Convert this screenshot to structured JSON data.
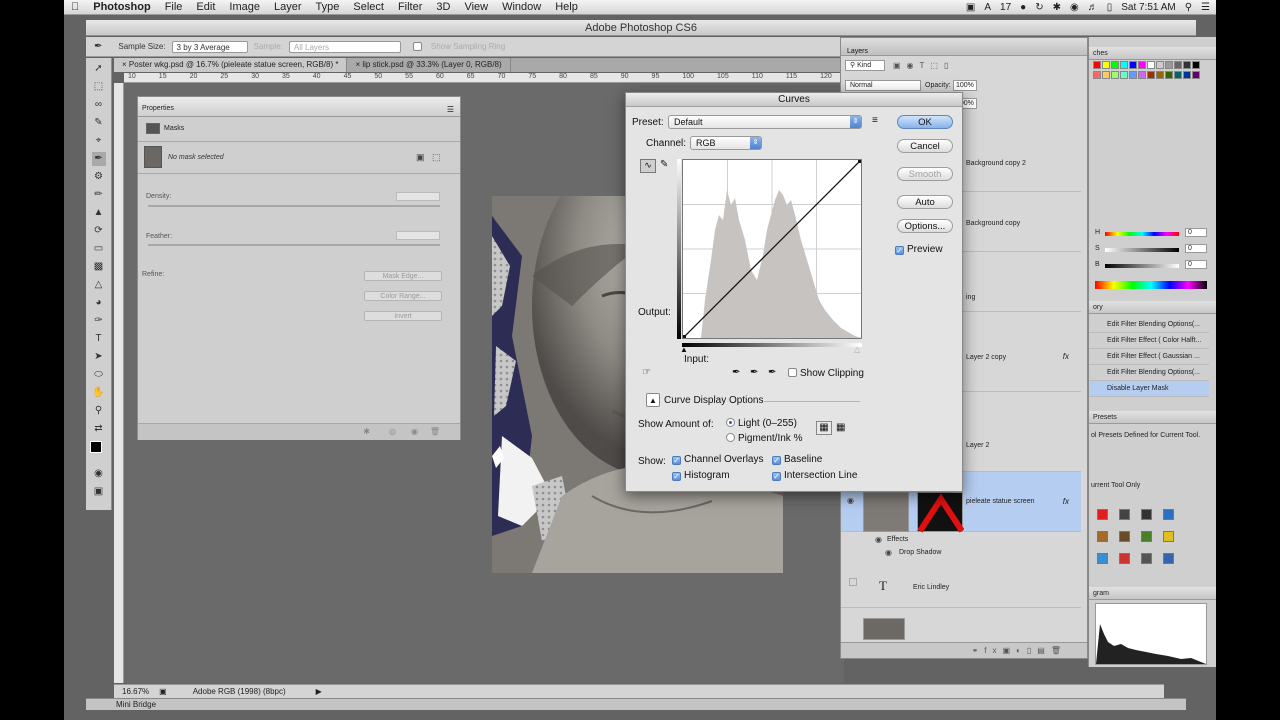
{
  "menubar": {
    "apple": "",
    "app_name": "Photoshop",
    "items": [
      "File",
      "Edit",
      "Image",
      "Layer",
      "Type",
      "Select",
      "Filter",
      "3D",
      "View",
      "Window",
      "Help"
    ],
    "status_number": "17",
    "clock": "Sat 7:51 AM"
  },
  "window": {
    "title": "Adobe Photoshop CS6"
  },
  "options_bar": {
    "sample_size_label": "Sample Size:",
    "sample_size_value": "3 by 3 Average",
    "sample_label": "Sample:",
    "sample_value": "All Layers",
    "show_ring": "Show Sampling Ring"
  },
  "doc_tabs": [
    {
      "label": "Poster wkg.psd @ 16.7% (pieleate statue screen, RGB/8) *"
    },
    {
      "label": "lip stick.psd @ 33.3% (Layer 0, RGB/8)"
    }
  ],
  "ruler_ticks": [
    "10",
    "15",
    "20",
    "25",
    "30",
    "35",
    "40",
    "45",
    "50",
    "55",
    "60",
    "65",
    "70",
    "75",
    "80",
    "85",
    "90",
    "95",
    "100",
    "105",
    "110",
    "115",
    "120",
    "125",
    "130",
    "135",
    "140",
    "145"
  ],
  "properties": {
    "title": "Properties",
    "section": "Masks",
    "no_mask": "No mask selected",
    "density": "Density:",
    "feather": "Feather:",
    "refine": "Refine:",
    "mask_edge": "Mask Edge...",
    "color_range": "Color Range...",
    "invert": "Invert"
  },
  "layers": {
    "title": "Layers",
    "kind": "Kind",
    "blend_mode": "Normal",
    "opacity_label": "Opacity:",
    "opacity_value": "100%",
    "fill_value": "100%",
    "items": [
      {
        "name": "Background copy 2"
      },
      {
        "name": "Background copy"
      },
      {
        "name": "ing"
      },
      {
        "name": "Layer 2 copy"
      },
      {
        "name": "Layer 2"
      },
      {
        "name": "pieleate statue screen"
      },
      {
        "name": "Effects"
      },
      {
        "name": "Drop Shadow"
      },
      {
        "name": "Eric Lindley"
      }
    ]
  },
  "right_panels": {
    "swatches_title": "ches",
    "color": {
      "h_label": "H",
      "s_label": "S",
      "b_label": "B",
      "h_value": "0",
      "s_value": "0",
      "b_value": "0",
      "pct": "%"
    },
    "history_title": "ory",
    "history_items": [
      "Edit Filter Blending Options(...",
      "Edit Filter Effect ( Color Halft...",
      "Edit Filter Effect ( Gaussian ...",
      "Edit Filter Blending Options(...",
      "Disable Layer Mask"
    ],
    "tool_presets_title": "Presets",
    "tool_presets_text": "ol Presets Defined for Current Tool.",
    "current_tool_only": "urrent Tool Only",
    "histogram_title": "gram"
  },
  "curves": {
    "title": "Curves",
    "preset_label": "Preset:",
    "preset_value": "Default",
    "channel_label": "Channel:",
    "channel_value": "RGB",
    "ok": "OK",
    "cancel": "Cancel",
    "smooth": "Smooth",
    "auto": "Auto",
    "options": "Options...",
    "preview": "Preview",
    "output": "Output:",
    "input": "Input:",
    "show_clipping": "Show Clipping",
    "curve_display_options": "Curve Display Options",
    "show_amount_of": "Show Amount of:",
    "light": "Light  (0–255)",
    "pigment": "Pigment/Ink %",
    "show": "Show:",
    "channel_overlays": "Channel Overlays",
    "baseline": "Baseline",
    "histogram": "Histogram",
    "intersection_line": "Intersection Line"
  },
  "status": {
    "zoom": "16.67%",
    "profile": "Adobe RGB (1998) (8bpc)"
  },
  "mini_bridge": "Mini Bridge",
  "colors": {
    "accent": "#5d8fd6",
    "selection": "#b6cdf2",
    "panel": "#d4d4d4"
  }
}
